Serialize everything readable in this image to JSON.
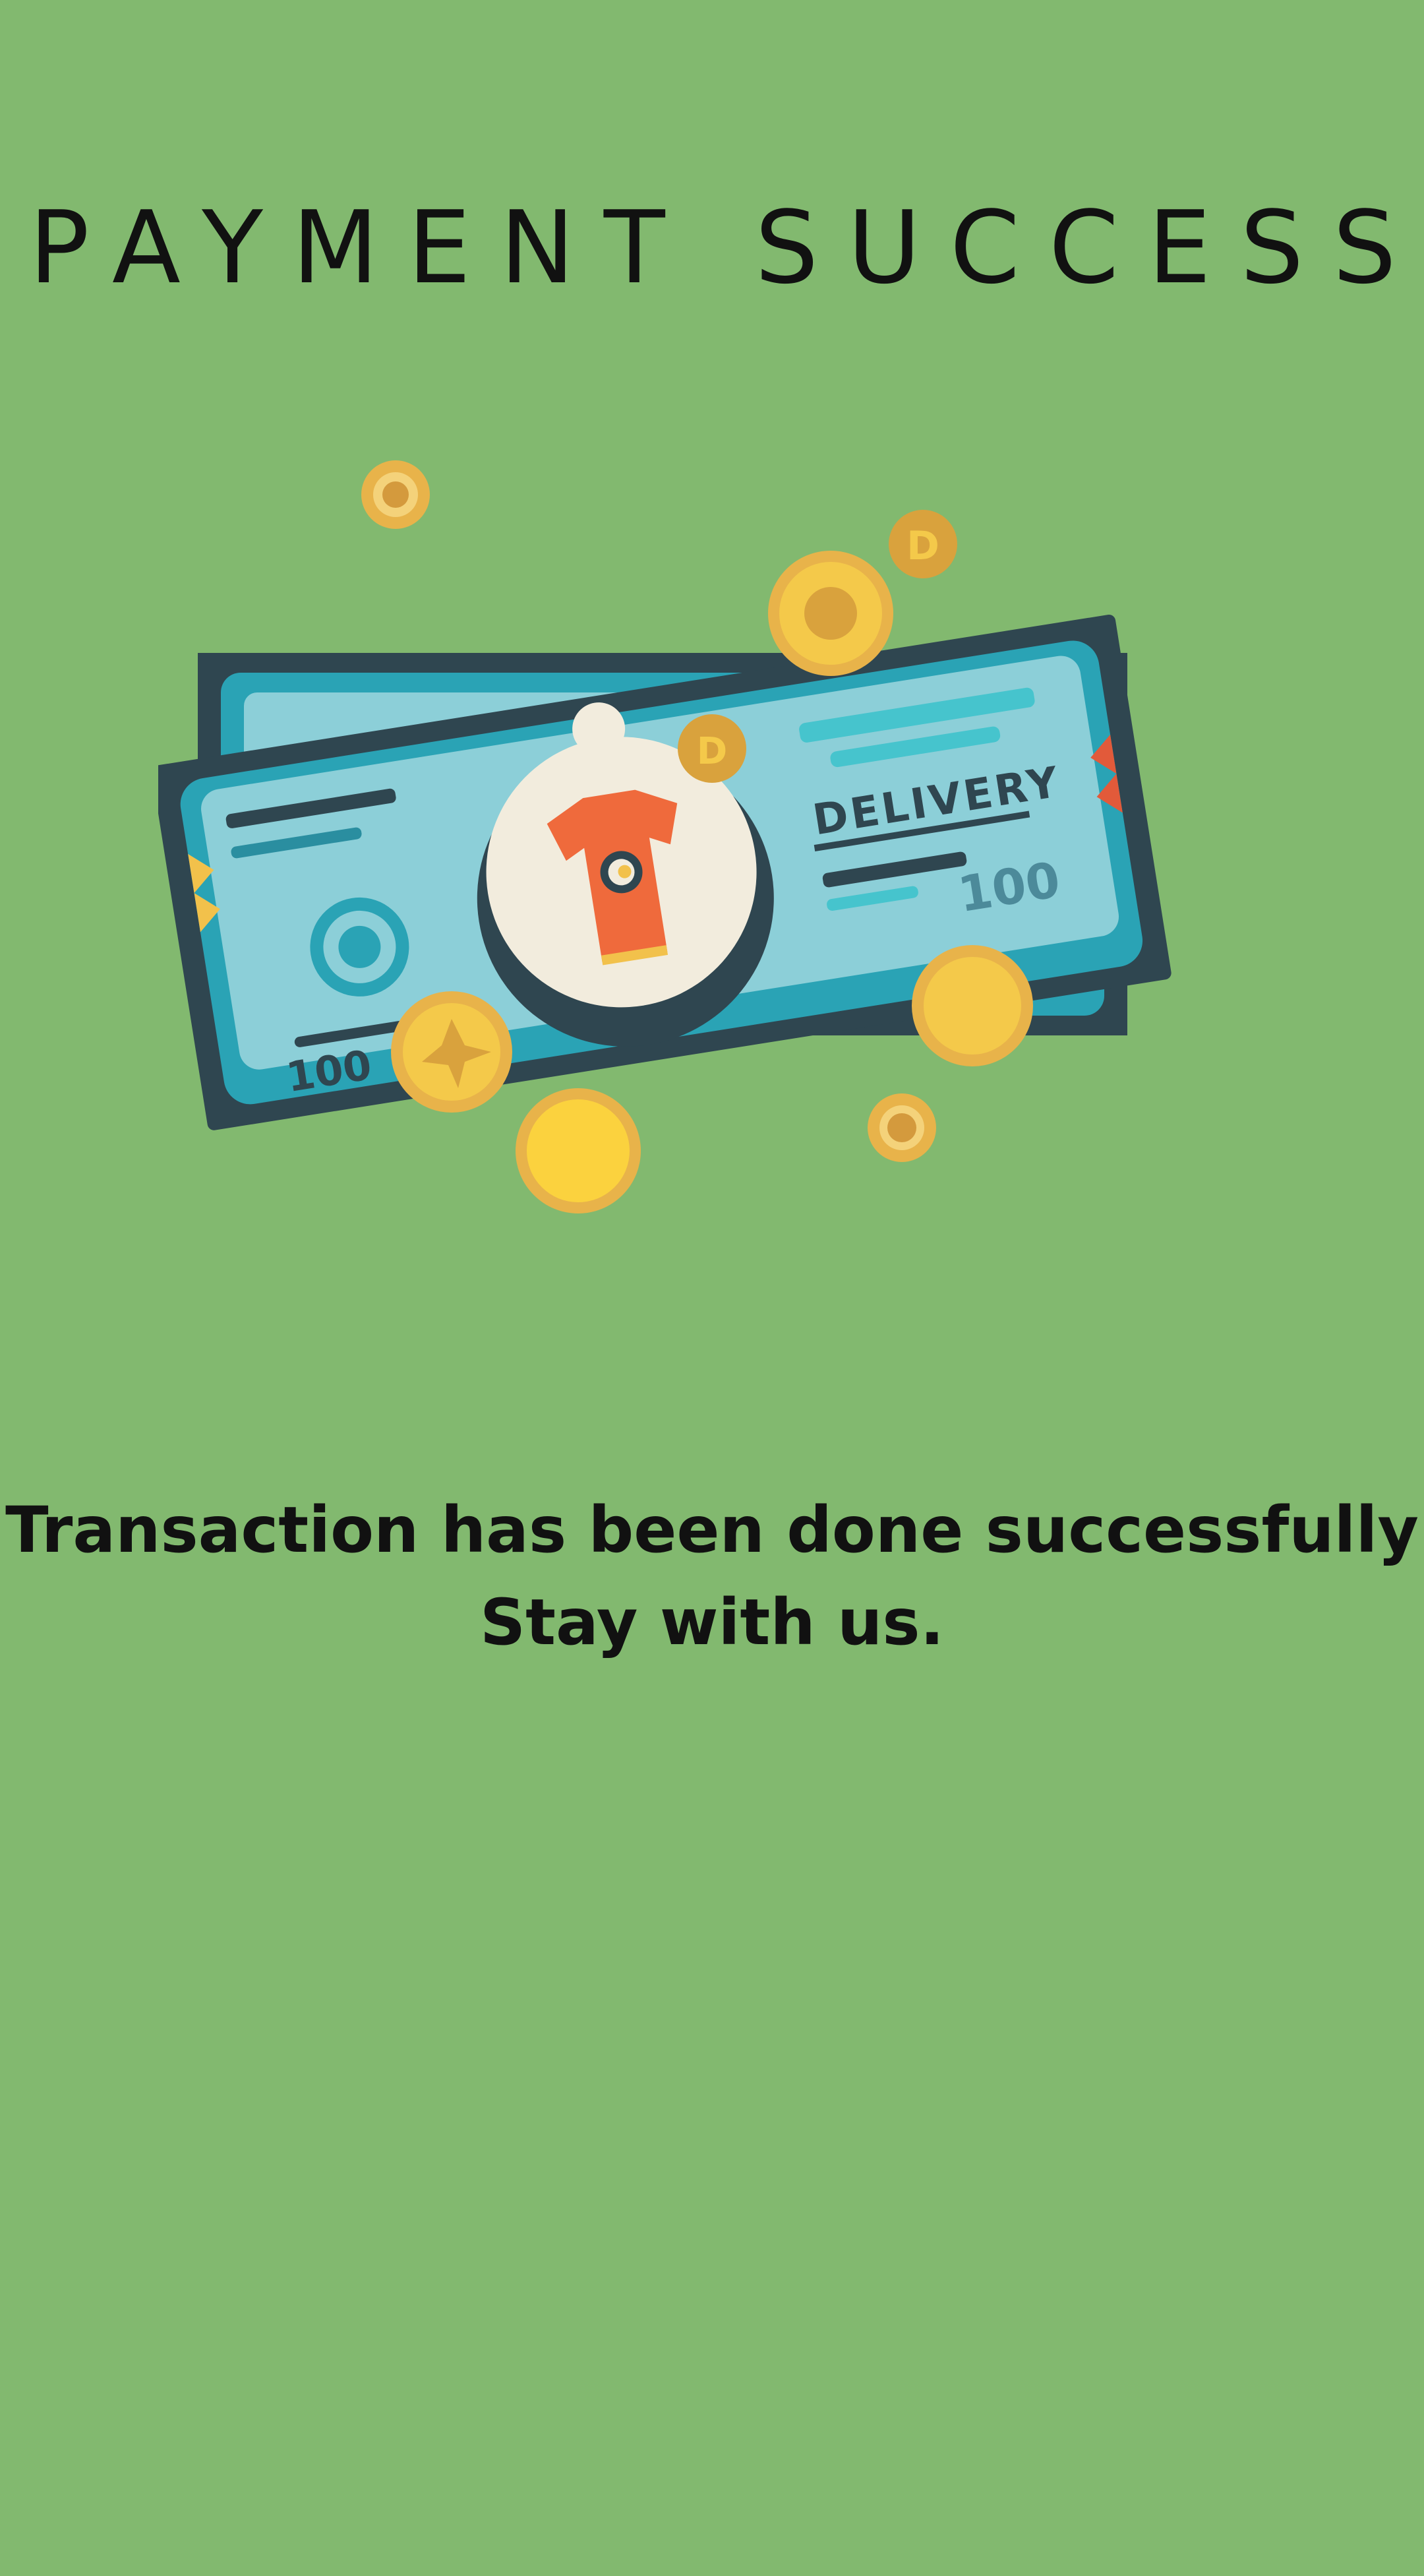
{
  "header": {
    "title": "PAYMENT SUCCESS"
  },
  "illustration": {
    "bill_label": "DELIVERY",
    "bill_value": "100",
    "bill_value_corner": "100",
    "icon": "shirt-icon"
  },
  "message": {
    "line1": "Transaction has been done successfully",
    "line2": "Stay with us."
  },
  "colors": {
    "background": "#82b96f",
    "bill_dark": "#2f4650",
    "bill_light": "#8ccfd8",
    "bill_mid": "#2aa3b5",
    "coin": "#f4c94a",
    "shirt": "#ef6a3c"
  }
}
